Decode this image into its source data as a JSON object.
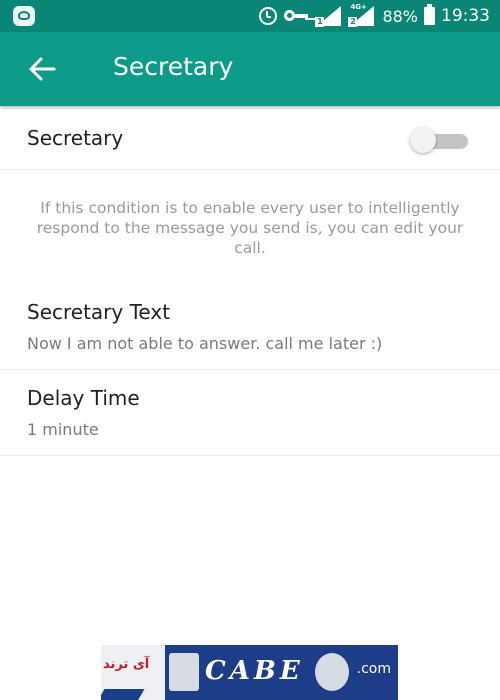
{
  "status_bar": {
    "battery": "88%",
    "time": "19:33",
    "sim1_label": "1",
    "sim2_label": "2",
    "sim2_network": "4G+",
    "icons": [
      "app-shield-icon",
      "alarm-icon",
      "key-icon",
      "signal-sim1-icon",
      "signal-sim2-icon",
      "battery-icon"
    ]
  },
  "toolbar": {
    "title": "Secretary",
    "back_icon": "arrow-left-icon",
    "background": "#0e9a88"
  },
  "secretary_toggle": {
    "label": "Secretary",
    "enabled": false
  },
  "description": "If this condition is to enable every user to intelligently respond to the message you send is, you can edit your call.",
  "secretary_text": {
    "title": "Secretary Text",
    "value": "Now I am not able to answer. call me later :)"
  },
  "delay_time": {
    "title": "Delay Time",
    "value": "1 minute"
  },
  "watermark": {
    "left_text": "آی ترند",
    "logo_letters": "CABE",
    "suffix": ".com"
  },
  "colors": {
    "status_bar": "#0b8575",
    "accent": "#0e9a88"
  }
}
